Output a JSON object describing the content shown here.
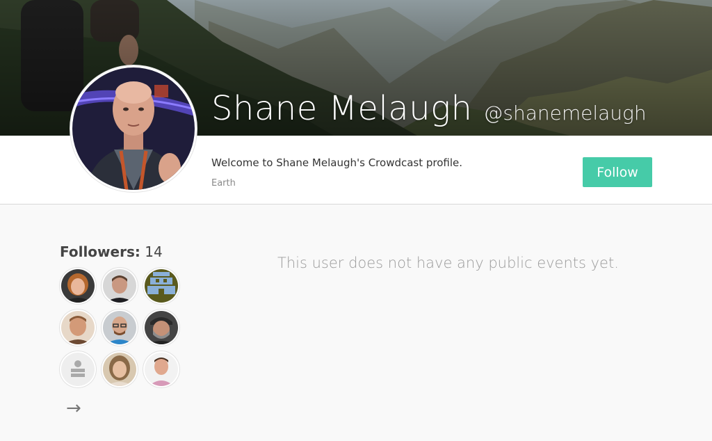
{
  "profile": {
    "name": "Shane Melaugh",
    "handle": "@shanemelaugh",
    "bio": "Welcome to Shane Melaugh's Crowdcast profile.",
    "location": "Earth",
    "follow_label": "Follow"
  },
  "followers": {
    "label": "Followers:",
    "count": "14",
    "more_arrow": "→",
    "avatars": [
      {
        "name": "follower-avatar-1"
      },
      {
        "name": "follower-avatar-2"
      },
      {
        "name": "follower-avatar-3"
      },
      {
        "name": "follower-avatar-4"
      },
      {
        "name": "follower-avatar-5"
      },
      {
        "name": "follower-avatar-6"
      },
      {
        "name": "follower-avatar-7-default"
      },
      {
        "name": "follower-avatar-8"
      },
      {
        "name": "follower-avatar-9"
      }
    ]
  },
  "events": {
    "empty_message": "This user does not have any public events yet."
  },
  "colors": {
    "accent": "#46cba8",
    "background": "#f9f9f9"
  }
}
